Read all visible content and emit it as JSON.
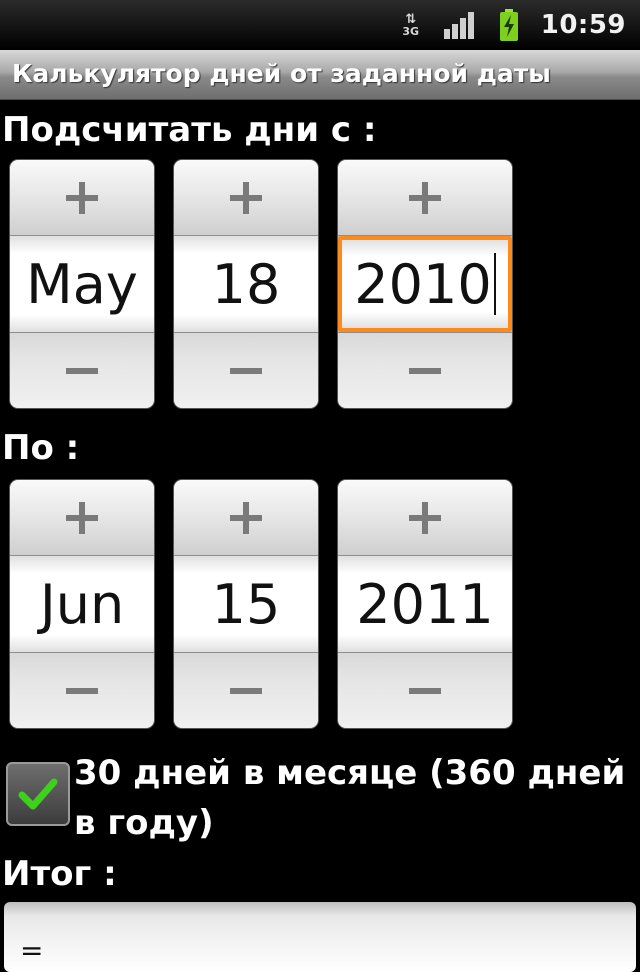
{
  "status_bar": {
    "network_type": "3G",
    "clock": "10:59",
    "icons": [
      "data-arrows-icon",
      "signal-icon",
      "battery-charging-icon"
    ]
  },
  "title_bar": {
    "title": "Калькулятор дней от заданной даты"
  },
  "from_section": {
    "label": "Подсчитать дни с :",
    "month": "May",
    "day": "18",
    "year": "2010"
  },
  "to_section": {
    "label": "По :",
    "month": "Jun",
    "day": "15",
    "year": "2011"
  },
  "option": {
    "label": "30 дней в месяце (360 дней в году)",
    "checked": true
  },
  "result": {
    "label": "Итог :",
    "value": "="
  },
  "colors": {
    "focus_border": "#ff8a1c",
    "check_mark": "#3ed11b",
    "background": "#000000"
  }
}
